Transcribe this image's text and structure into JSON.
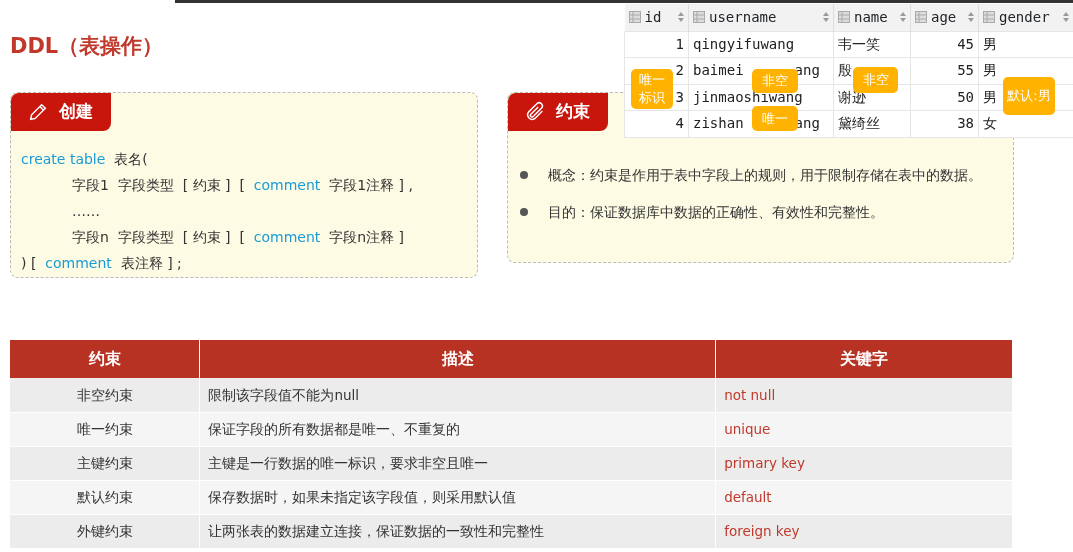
{
  "title": "DDL（表操作）",
  "create_card": {
    "heading": "创建",
    "lines": [
      {
        "indent": false,
        "parts": [
          {
            "kind": "keyword",
            "text": "create table"
          },
          {
            "kind": "plain",
            "text": "表名("
          }
        ]
      },
      {
        "indent": true,
        "parts": [
          {
            "kind": "plain",
            "text": "字段1  字段类型  [ 约束 ]  ["
          },
          {
            "kind": "keyword",
            "text": "comment"
          },
          {
            "kind": "plain",
            "text": "字段1注释 ] ,"
          }
        ]
      },
      {
        "indent": true,
        "parts": [
          {
            "kind": "plain",
            "text": "……"
          }
        ]
      },
      {
        "indent": true,
        "parts": [
          {
            "kind": "plain",
            "text": "字段n  字段类型  [ 约束 ]  ["
          },
          {
            "kind": "keyword",
            "text": "comment"
          },
          {
            "kind": "plain",
            "text": "字段n注释 ]"
          }
        ]
      },
      {
        "indent": false,
        "parts": [
          {
            "kind": "plain",
            "text": ") ["
          },
          {
            "kind": "keyword",
            "text": "comment"
          },
          {
            "kind": "plain",
            "text": "表注释 ] ;"
          }
        ]
      }
    ]
  },
  "constraint_card": {
    "heading": "约束",
    "bullets": [
      "概念：约束是作用于表中字段上的规则，用于限制存储在表中的数据。",
      "目的：保证数据库中数据的正确性、有效性和完整性。"
    ]
  },
  "db_table": {
    "columns": [
      "id",
      "username",
      "name",
      "age",
      "gender"
    ],
    "rows": [
      {
        "id": "1",
        "username": [
          "qingyifuwang"
        ],
        "name": [
          "韦一笑"
        ],
        "age": "45",
        "gender": "男"
      },
      {
        "id": "2",
        "username": [
          "baimei",
          "ang"
        ],
        "name": [
          "殷"
        ],
        "age": "55",
        "gender": "男"
      },
      {
        "id": "3",
        "username": [
          "jinmaoshiwang"
        ],
        "name": [
          "谢逊"
        ],
        "age": "50",
        "gender": "男"
      },
      {
        "id": "4",
        "username": [
          "zishan",
          "ang"
        ],
        "name": [
          "黛绮丝"
        ],
        "age": "38",
        "gender": "女"
      }
    ],
    "badges": [
      "唯一标识",
      "非空",
      "非空",
      "唯一",
      "默认:男"
    ]
  },
  "constraints_table": {
    "columns": [
      "约束",
      "描述",
      "关键字"
    ],
    "rows": [
      [
        "非空约束",
        "限制该字段值不能为null",
        "not  null"
      ],
      [
        "唯一约束",
        "保证字段的所有数据都是唯一、不重复的",
        "unique"
      ],
      [
        "主键约束",
        "主键是一行数据的唯一标识，要求非空且唯一",
        "primary  key"
      ],
      [
        "默认约束",
        "保存数据时，如果未指定该字段值，则采用默认值",
        "default"
      ],
      [
        "外键约束",
        "让两张表的数据建立连接，保证数据的一致性和完整性",
        "foreign  key"
      ]
    ]
  }
}
